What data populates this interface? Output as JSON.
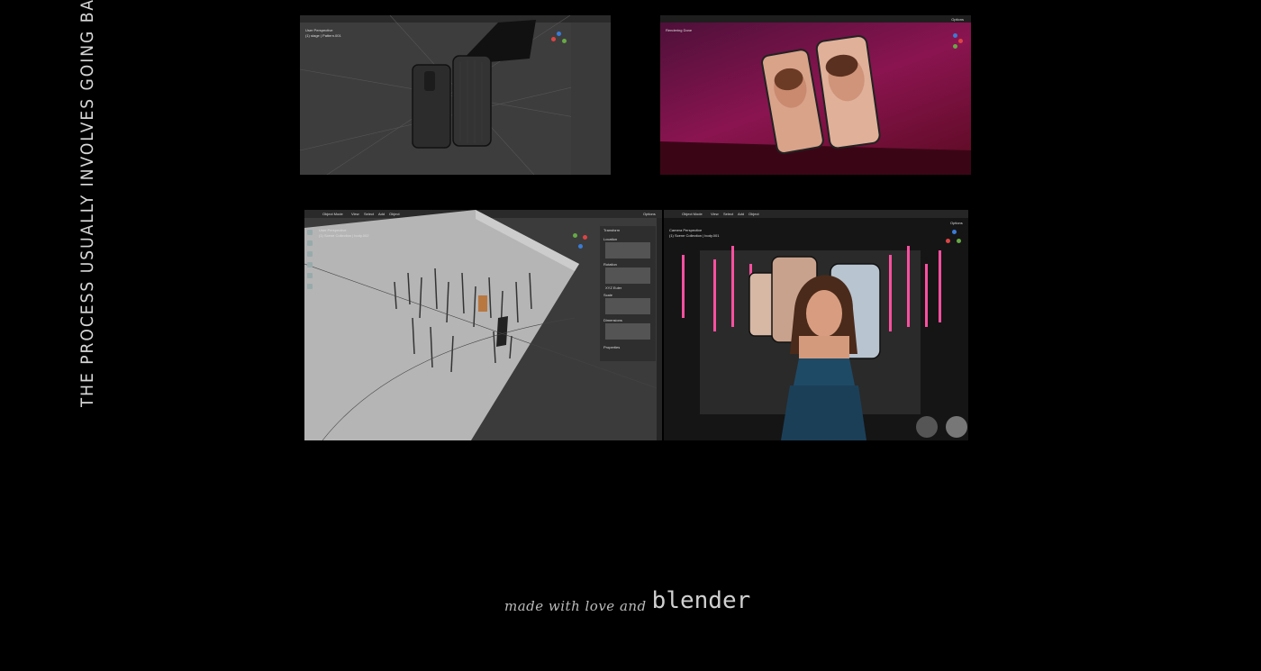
{
  "side_caption": "THE PROCESS USUALLY INVOLVES GOING BACK AND",
  "shots": [
    {
      "name": "viewport-wireframe-phones",
      "labels": [
        "User Perspective",
        "(1) stage | Pattern.001"
      ]
    },
    {
      "name": "render-pink-wall-phones",
      "labels": [
        "Rendering Done"
      ],
      "options": "Options"
    },
    {
      "name": "viewport-scene-overview",
      "labels": [
        "User Perspective",
        "(1) Scene Collection | body.002"
      ],
      "menu": [
        "Object Mode",
        "View",
        "Select",
        "Add",
        "Object"
      ],
      "transform": "Transform",
      "location": "Location",
      "rotation": "Rotation",
      "scale": "Scale",
      "dimensions": "Dimensions",
      "properties": "Properties",
      "rotmode": "XYZ Euler",
      "options": "Options"
    },
    {
      "name": "viewport-render-woman",
      "labels": [
        "Camera Perspective",
        "(1) Scene Collection | body.001"
      ],
      "menu": [
        "Object Mode",
        "View",
        "Select",
        "Add",
        "Object"
      ],
      "options": "Options"
    }
  ],
  "footer": {
    "script": "made with love and",
    "brand": "blender"
  }
}
